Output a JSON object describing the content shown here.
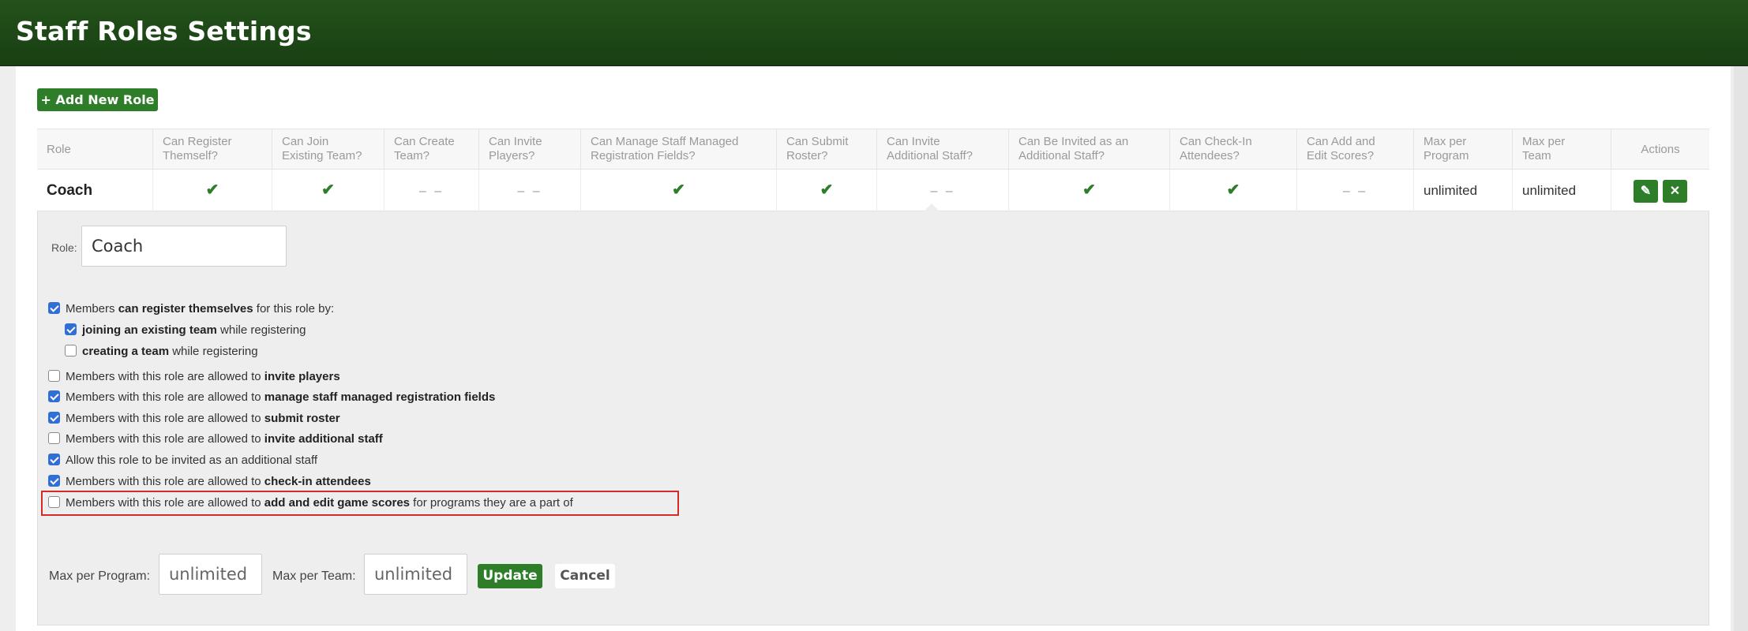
{
  "page": {
    "title": "Staff Roles Settings"
  },
  "toolbar": {
    "add_label": "+ Add New Role"
  },
  "table": {
    "headers": [
      "Role",
      "Can Register\nThemself?",
      "Can Join\nExisting Team?",
      "Can Create\nTeam?",
      "Can Invite\nPlayers?",
      "Can Manage Staff Managed\nRegistration Fields?",
      "Can Submit\nRoster?",
      "Can Invite\nAdditional Staff?",
      "Can Be Invited as an\nAdditional Staff?",
      "Can Check-In\nAttendees?",
      "Can Add and\nEdit Scores?",
      "Max per\nProgram",
      "Max per\nTeam",
      "Actions"
    ],
    "row": {
      "role": "Coach",
      "cells": [
        "✔",
        "✔",
        "– –",
        "– –",
        "✔",
        "✔",
        "– –",
        "✔",
        "✔",
        "– –"
      ],
      "max_program": "unlimited",
      "max_team": "unlimited",
      "edit_icon": "pencil-icon",
      "delete_icon": "close-icon"
    }
  },
  "edit": {
    "role_label": "Role:",
    "role_value": "Coach",
    "options": [
      {
        "checked": true,
        "pre": "Members ",
        "bold": "can register themselves",
        "post": " for this role by:"
      },
      {
        "checked": true,
        "pre": "",
        "bold": "joining an existing team",
        "post": " while registering"
      },
      {
        "checked": false,
        "pre": "",
        "bold": "creating a team",
        "post": " while registering"
      },
      {
        "checked": false,
        "pre": "Members with this role are allowed to ",
        "bold": "invite players",
        "post": ""
      },
      {
        "checked": true,
        "pre": "Members with this role are allowed to ",
        "bold": "manage staff managed registration fields",
        "post": ""
      },
      {
        "checked": true,
        "pre": "Members with this role are allowed to ",
        "bold": "submit roster",
        "post": ""
      },
      {
        "checked": false,
        "pre": "Members with this role are allowed to ",
        "bold": "invite additional staff",
        "post": ""
      },
      {
        "checked": true,
        "pre": "Allow this role to be invited as an additional staff",
        "bold": "",
        "post": ""
      },
      {
        "checked": true,
        "pre": "Members with this role are allowed to ",
        "bold": "check-in attendees",
        "post": ""
      },
      {
        "checked": false,
        "pre": "Members with this role are allowed to ",
        "bold": "add and edit game scores",
        "post": " for programs they are a part of"
      }
    ],
    "max_program_label": "Max per Program:",
    "max_program_value": "unlimited",
    "max_team_label": "Max per Team:",
    "max_team_value": "unlimited",
    "update_label": "Update",
    "cancel_label": "Cancel"
  },
  "colors": {
    "brand_green": "#2e7d28",
    "header_green": "#1e4a17",
    "highlight_red": "#d42a2a",
    "checkbox_blue": "#2f6fd6"
  }
}
